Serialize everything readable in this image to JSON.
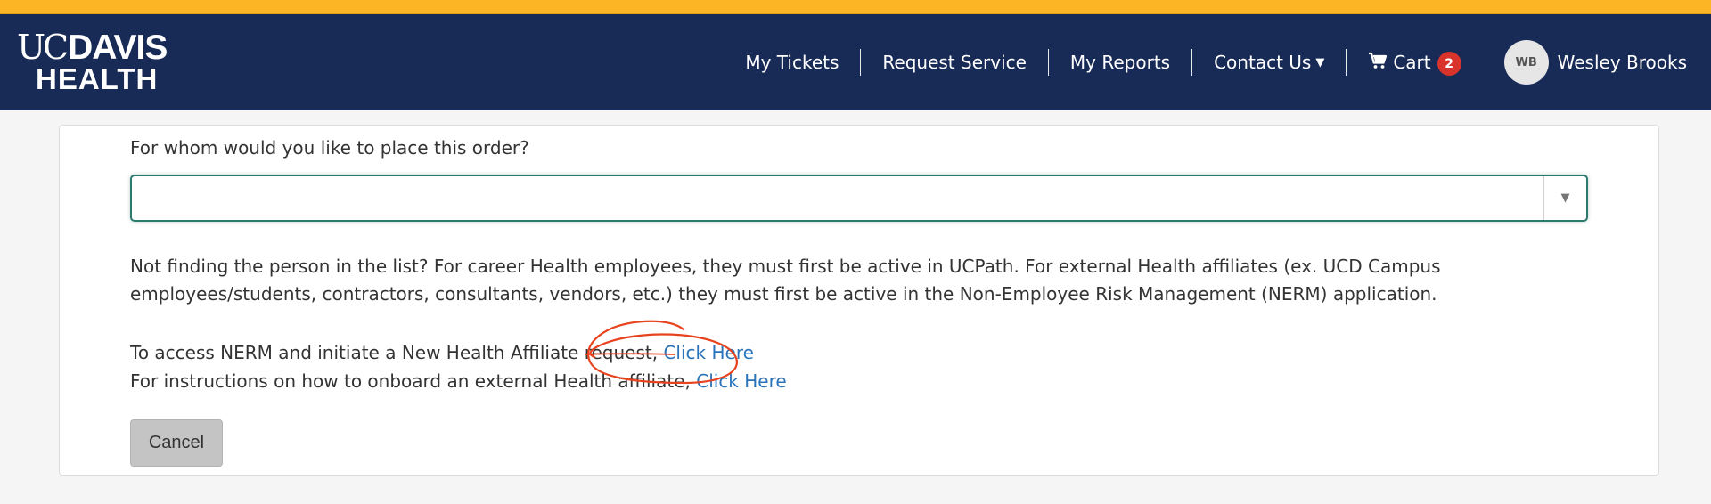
{
  "header": {
    "logo": {
      "uc": "UC",
      "davis": "DAVIS",
      "health": "HEALTH"
    },
    "nav": [
      {
        "label": "My Tickets"
      },
      {
        "label": "Request Service"
      },
      {
        "label": "My Reports"
      },
      {
        "label": "Contact Us"
      }
    ],
    "cart": {
      "label": "Cart",
      "count": "2"
    },
    "user": {
      "initials": "WB",
      "name": "Wesley Brooks"
    }
  },
  "form": {
    "question": "For whom would you like to place this order?",
    "select_value": "",
    "info_text": "Not finding the person in the list? For career Health employees, they must first be active in UCPath. For external Health affiliates (ex. UCD Campus employees/students, contractors, consultants, vendors, etc.) they must first be active in the Non-Employee Risk Management (NERM) application.",
    "nerm_prefix": "To access NERM and initiate a New Health Affiliate request, ",
    "nerm_link": "Click Here",
    "onboard_prefix": "For instructions on how to onboard an external Health affiliate, ",
    "onboard_link": "Click Here",
    "cancel_label": "Cancel"
  },
  "colors": {
    "gold": "#fcb525",
    "navy": "#182a56",
    "link": "#2a73b8",
    "badge": "#d9342b",
    "focus_border": "#2c7a6e",
    "annotation": "#e8431e"
  },
  "icons": [
    "cart-icon",
    "caret-down-icon",
    "dropdown-arrow-icon"
  ]
}
